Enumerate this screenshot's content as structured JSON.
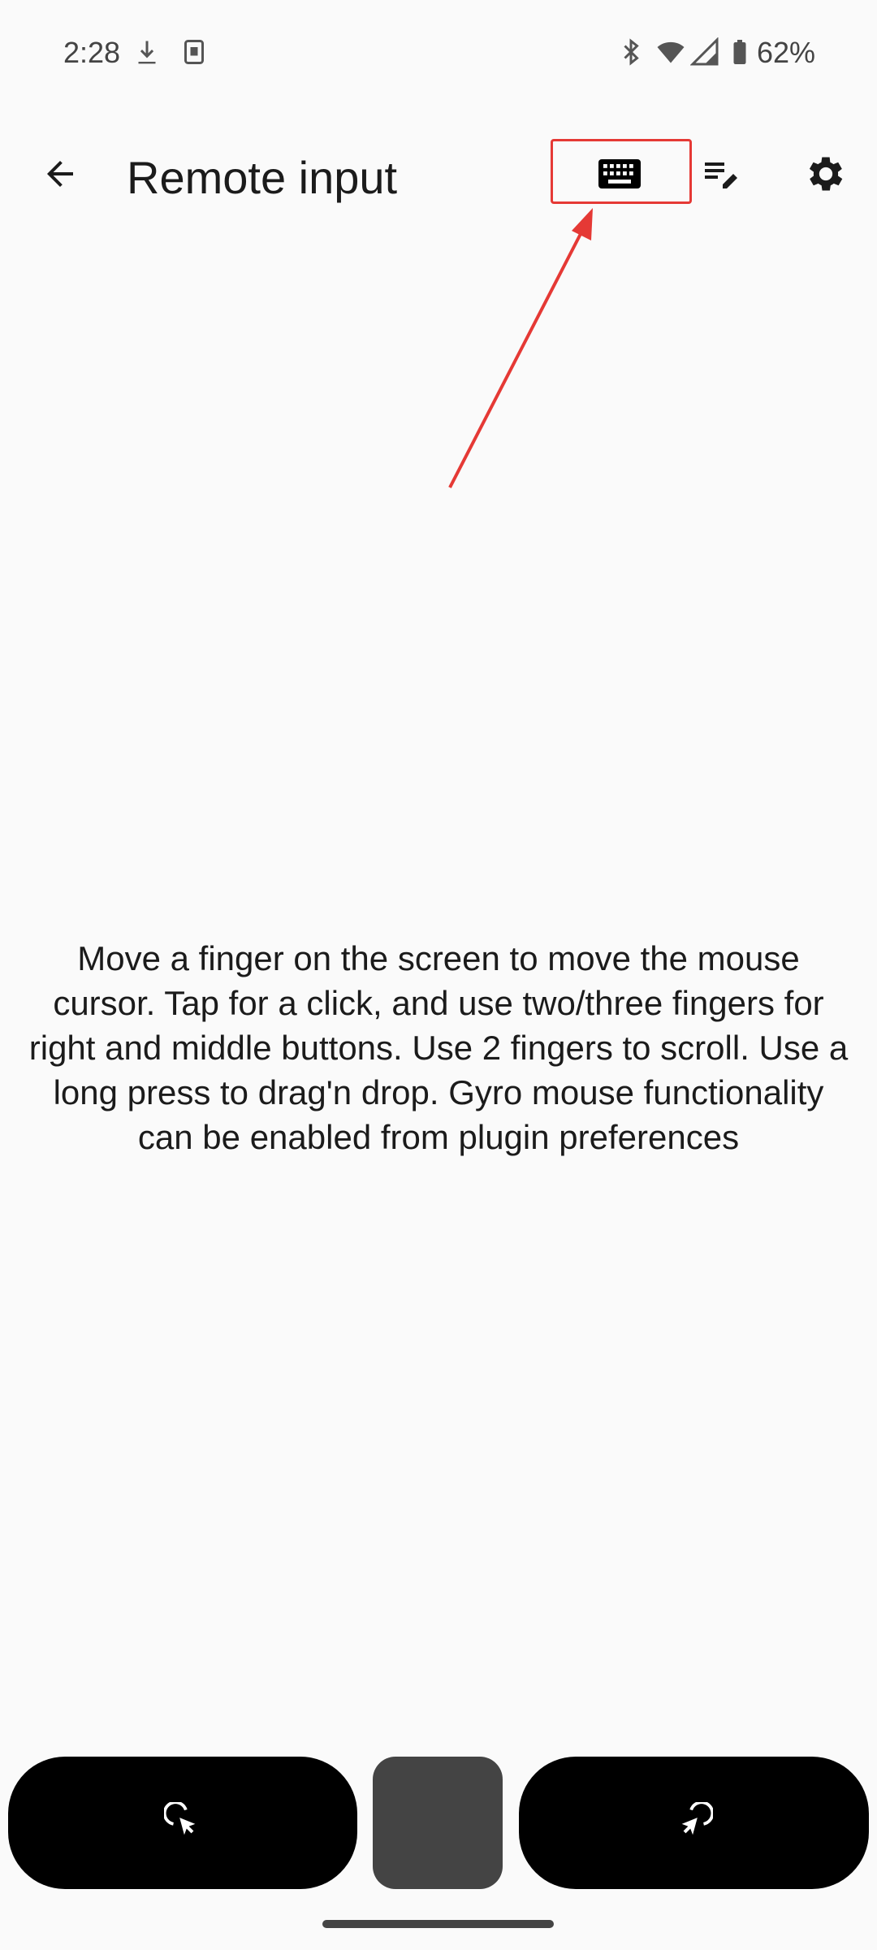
{
  "status_bar": {
    "time": "2:28",
    "battery_percent": "62%",
    "icons": [
      "download-icon",
      "notification-app-icon",
      "bluetooth-icon",
      "wifi-icon",
      "cell-signal-icon",
      "battery-icon"
    ]
  },
  "app_bar": {
    "title": "Remote input",
    "back_icon": "arrow-back-icon",
    "actions": [
      {
        "name": "keyboard-button",
        "icon": "keyboard-icon"
      },
      {
        "name": "edit-text-button",
        "icon": "playlist-edit-icon"
      },
      {
        "name": "settings-button",
        "icon": "gear-icon"
      }
    ]
  },
  "annotation": {
    "color": "#e53935",
    "target": "keyboard-button"
  },
  "main": {
    "instructions": "Move a finger on the screen to move the mouse cursor. Tap for a click, and use two/three fingers for right and middle buttons. Use 2 fingers to scroll. Use a long press to drag'n drop. Gyro mouse functionality can be enabled from plugin preferences"
  },
  "bottom_buttons": [
    {
      "name": "left-click-button",
      "icon": "left-click-icon"
    },
    {
      "name": "middle-click-button",
      "icon": ""
    },
    {
      "name": "right-click-button",
      "icon": "right-click-icon"
    }
  ]
}
